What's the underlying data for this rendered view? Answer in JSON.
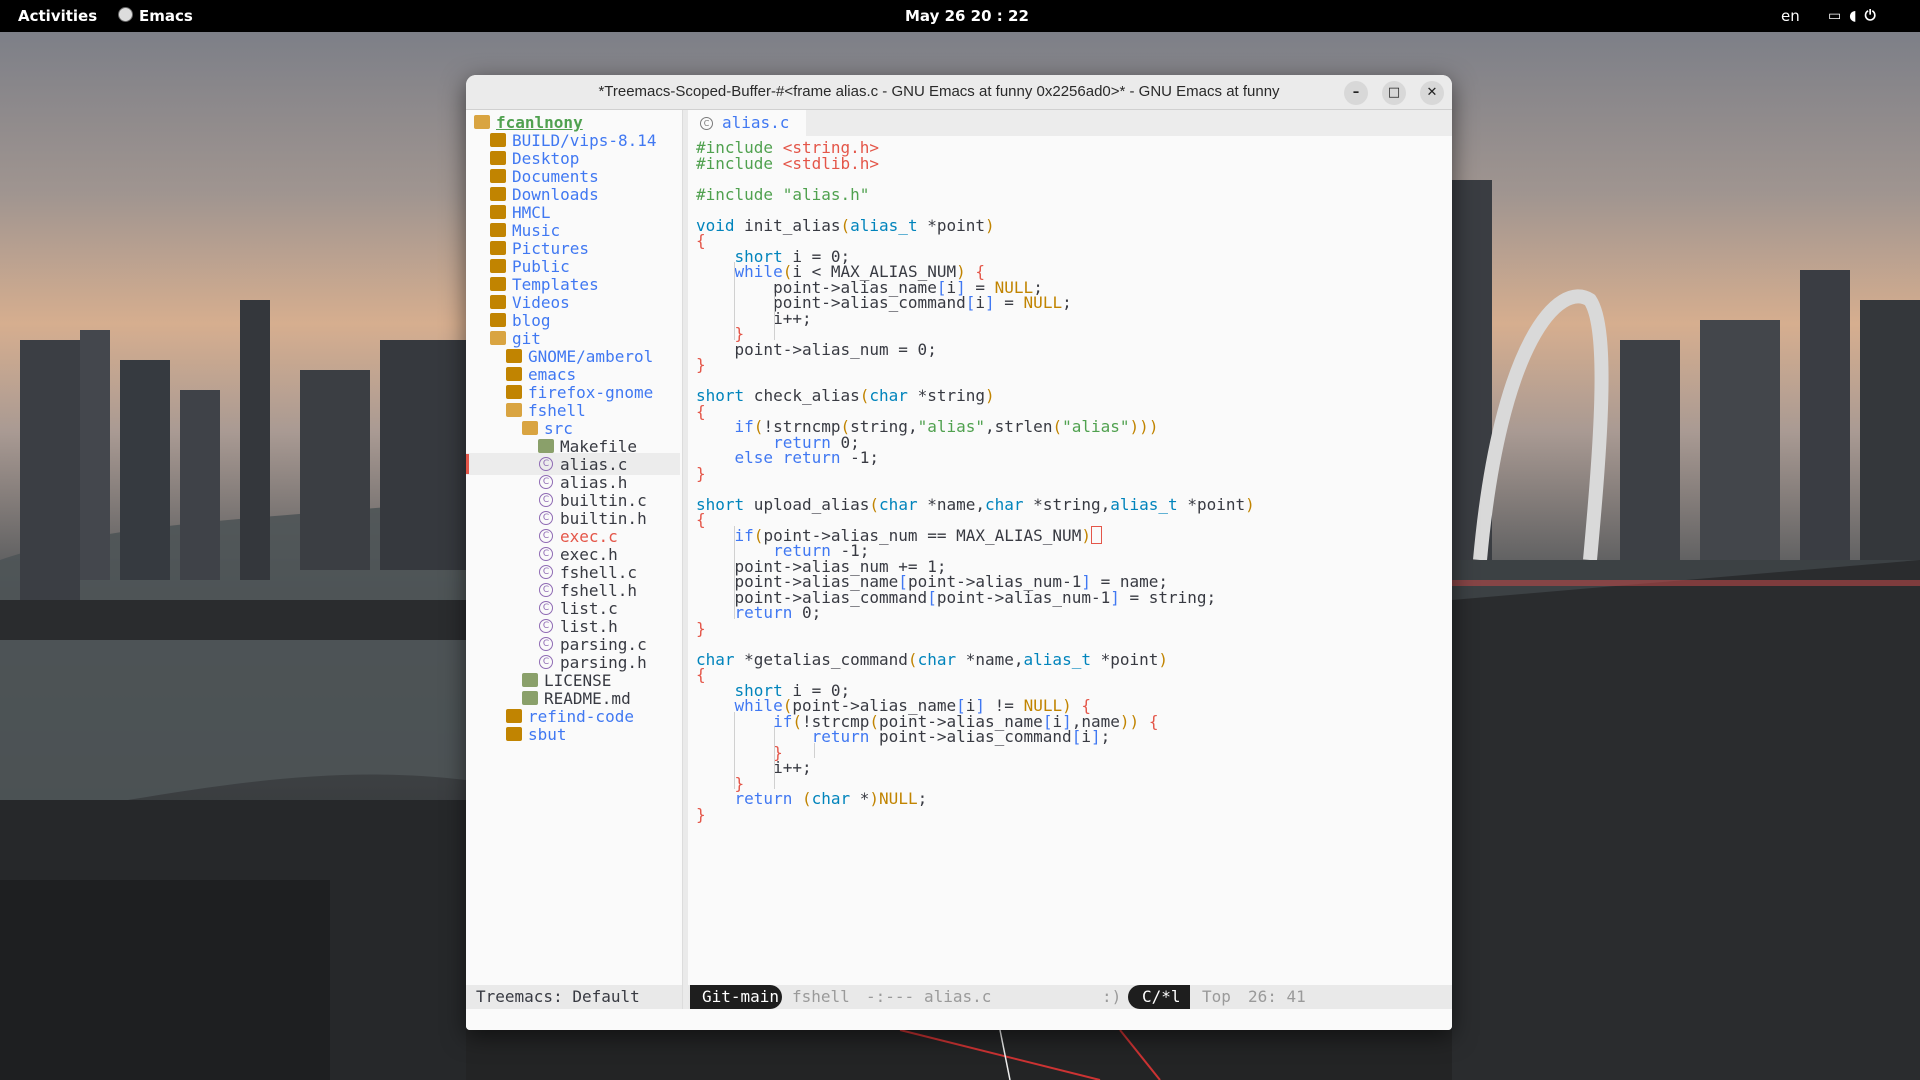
{
  "topbar": {
    "activities": "Activities",
    "app": "Emacs",
    "clock": "May 26  20 : 22",
    "lang": "en",
    "tray_icons": [
      "screen-icon",
      "volume-icon",
      "power-icon"
    ]
  },
  "window": {
    "title": "*Treemacs-Scoped-Buffer-#<frame alias.c - GNU Emacs at funny 0x2256ad0>* - GNU Emacs at funny",
    "buttons": [
      "minimize",
      "maximize",
      "close"
    ]
  },
  "treemacs": {
    "root": "fcanlnony",
    "items": [
      {
        "label": "BUILD/vips-8.14",
        "type": "dir"
      },
      {
        "label": "Desktop",
        "type": "dir"
      },
      {
        "label": "Documents",
        "type": "dir"
      },
      {
        "label": "Downloads",
        "type": "dir"
      },
      {
        "label": "HMCL",
        "type": "dir"
      },
      {
        "label": "Music",
        "type": "dir"
      },
      {
        "label": "Pictures",
        "type": "dir"
      },
      {
        "label": "Public",
        "type": "dir"
      },
      {
        "label": "Templates",
        "type": "dir"
      },
      {
        "label": "Videos",
        "type": "dir"
      },
      {
        "label": "blog",
        "type": "dir"
      },
      {
        "label": "git",
        "type": "dir"
      },
      {
        "label": "GNOME/amberol",
        "type": "dir"
      },
      {
        "label": "emacs",
        "type": "dir"
      },
      {
        "label": "firefox-gnome",
        "type": "dir"
      },
      {
        "label": "fshell",
        "type": "dir"
      },
      {
        "label": "src",
        "type": "dir"
      },
      {
        "label": "Makefile",
        "type": "file"
      },
      {
        "label": "alias.c",
        "type": "file"
      },
      {
        "label": "alias.h",
        "type": "file"
      },
      {
        "label": "builtin.c",
        "type": "file"
      },
      {
        "label": "builtin.h",
        "type": "file"
      },
      {
        "label": "exec.c",
        "type": "file"
      },
      {
        "label": "exec.h",
        "type": "file"
      },
      {
        "label": "fshell.c",
        "type": "file"
      },
      {
        "label": "fshell.h",
        "type": "file"
      },
      {
        "label": "list.c",
        "type": "file"
      },
      {
        "label": "list.h",
        "type": "file"
      },
      {
        "label": "parsing.c",
        "type": "file"
      },
      {
        "label": "parsing.h",
        "type": "file"
      },
      {
        "label": "LICENSE",
        "type": "file"
      },
      {
        "label": "README.md",
        "type": "file"
      },
      {
        "label": "refind-code",
        "type": "dir"
      },
      {
        "label": "sbut",
        "type": "dir"
      }
    ],
    "status": "Treemacs: Default"
  },
  "editor": {
    "tab": "alias.c",
    "lines": [
      "#include <string.h>",
      "#include <stdlib.h>",
      "",
      "#include \"alias.h\"",
      "",
      "void init_alias(alias_t *point)",
      "{",
      "    short i = 0;",
      "    while(i < MAX_ALIAS_NUM) {",
      "        point->alias_name[i] = NULL;",
      "        point->alias_command[i] = NULL;",
      "        i++;",
      "    }",
      "    point->alias_num = 0;",
      "}",
      "",
      "short check_alias(char *string)",
      "{",
      "    if(!strncmp(string,\"alias\",strlen(\"alias\")))",
      "        return 0;",
      "    else return -1;",
      "}",
      "",
      "short upload_alias(char *name,char *string,alias_t *point)",
      "{",
      "    if(point->alias_num == MAX_ALIAS_NUM)",
      "        return -1;",
      "    point->alias_num += 1;",
      "    point->alias_name[point->alias_num-1] = name;",
      "    point->alias_command[point->alias_num-1] = string;",
      "    return 0;",
      "}",
      "",
      "char *getalias_command(char *name,alias_t *point)",
      "{",
      "    short i = 0;",
      "    while(point->alias_name[i] != NULL) {",
      "        if(!strcmp(point->alias_name[i],name)) {",
      "            return point->alias_command[i];",
      "        }",
      "        i++;",
      "    }",
      "    return (char *)NULL;",
      "}"
    ]
  },
  "modeline": {
    "git": "Git-main",
    "project": "fshell",
    "modified": "-:---",
    "file": "alias.c",
    "smile": ":)",
    "mode": "C/*l",
    "position": "Top",
    "line_col": "26: 41"
  },
  "colors": {
    "keyword": "#4078f2",
    "type": "#0184bc",
    "string": "#50a14f",
    "variable": "#e45649",
    "param": "#c18401",
    "folder": "#c18401"
  }
}
